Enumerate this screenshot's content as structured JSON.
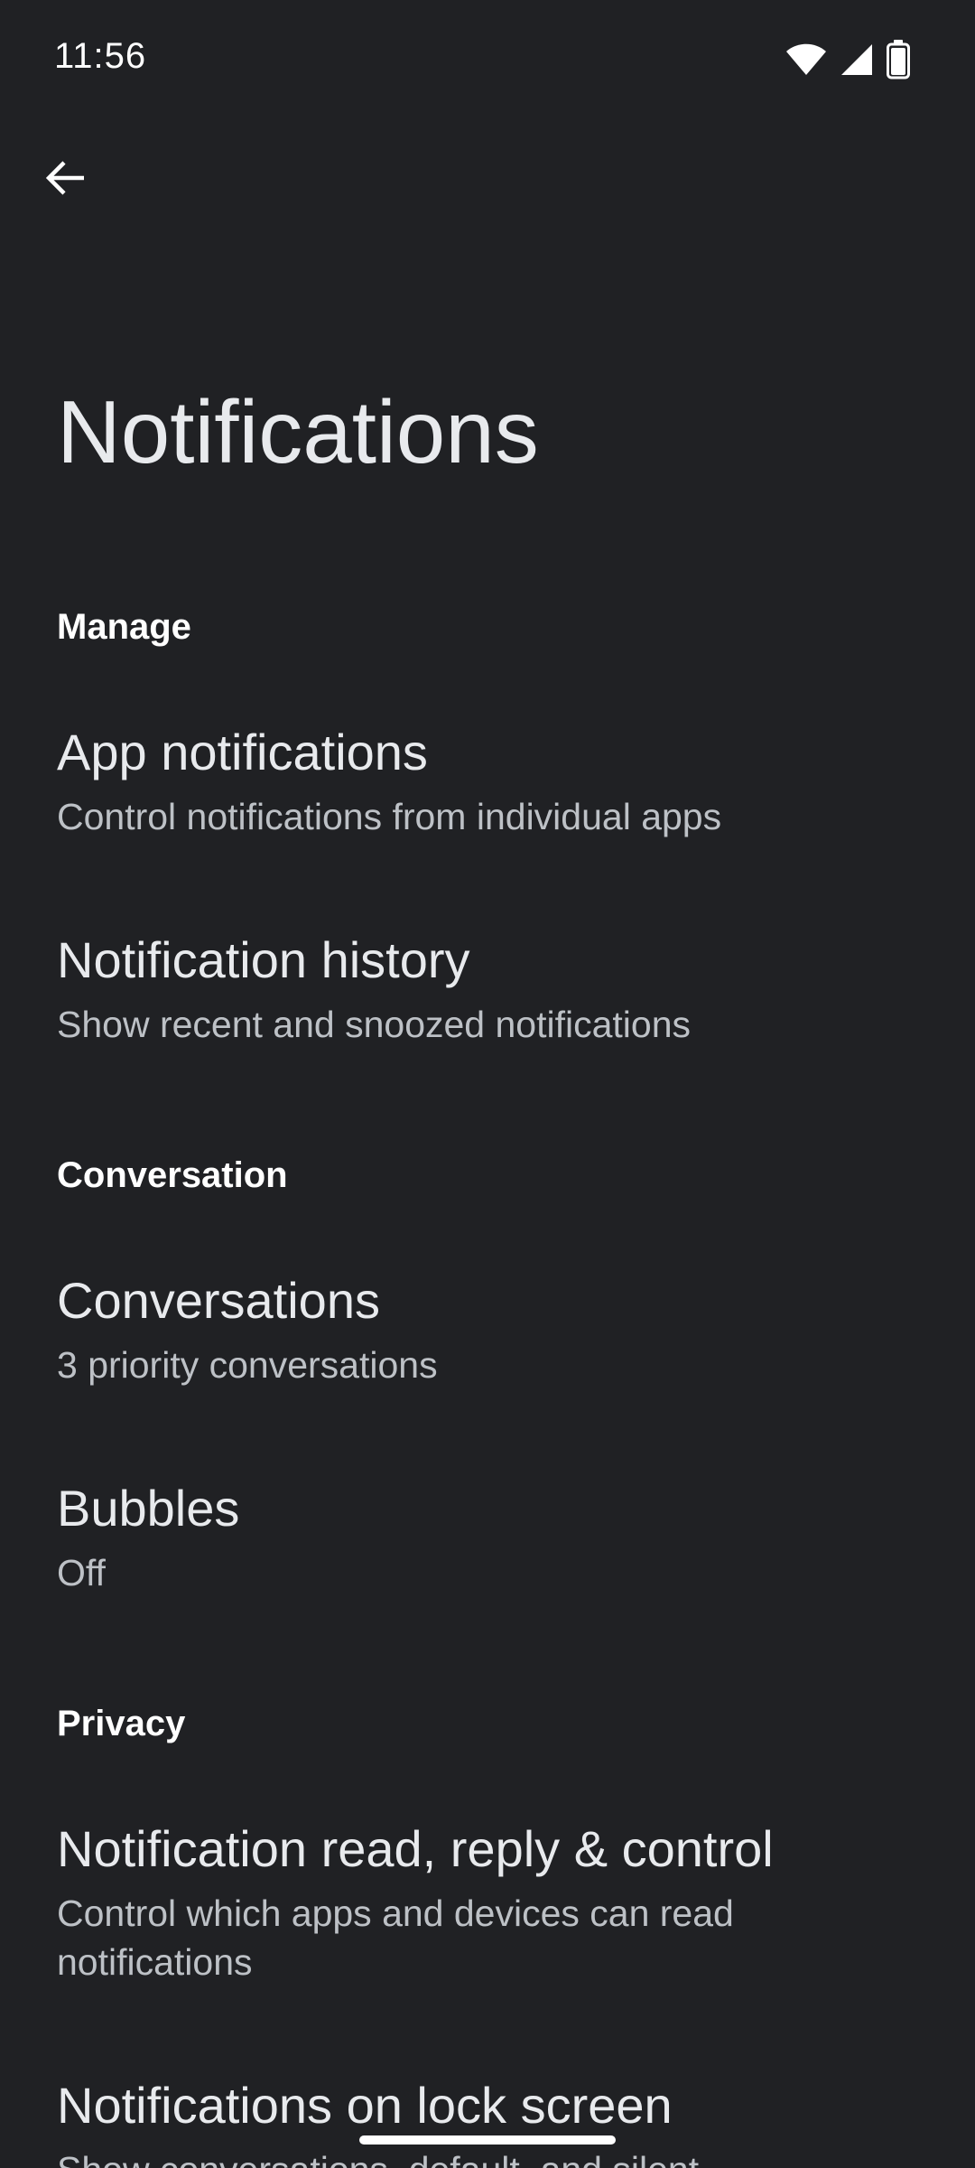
{
  "status_bar": {
    "time": "11:56",
    "icons": [
      "wifi-icon",
      "cell-signal-icon",
      "battery-icon"
    ]
  },
  "header": {
    "back_icon": "arrow-back-icon",
    "title": "Notifications"
  },
  "sections": [
    {
      "header": "Manage",
      "items": [
        {
          "title": "App notifications",
          "summary": "Control notifications from individual apps"
        },
        {
          "title": "Notification history",
          "summary": "Show recent and snoozed notifications"
        }
      ]
    },
    {
      "header": "Conversation",
      "items": [
        {
          "title": "Conversations",
          "summary": "3 priority conversations"
        },
        {
          "title": "Bubbles",
          "summary": "Off"
        }
      ]
    },
    {
      "header": "Privacy",
      "items": [
        {
          "title": "Notification read, reply & control",
          "summary": "Control which apps and devices can read notifications"
        },
        {
          "title": "Notifications on lock screen",
          "summary": "Show conversations, default, and silent"
        }
      ]
    }
  ],
  "colors": {
    "background": "#202124",
    "title_text": "#e8eaed",
    "summary_text": "#bdc1c6"
  }
}
